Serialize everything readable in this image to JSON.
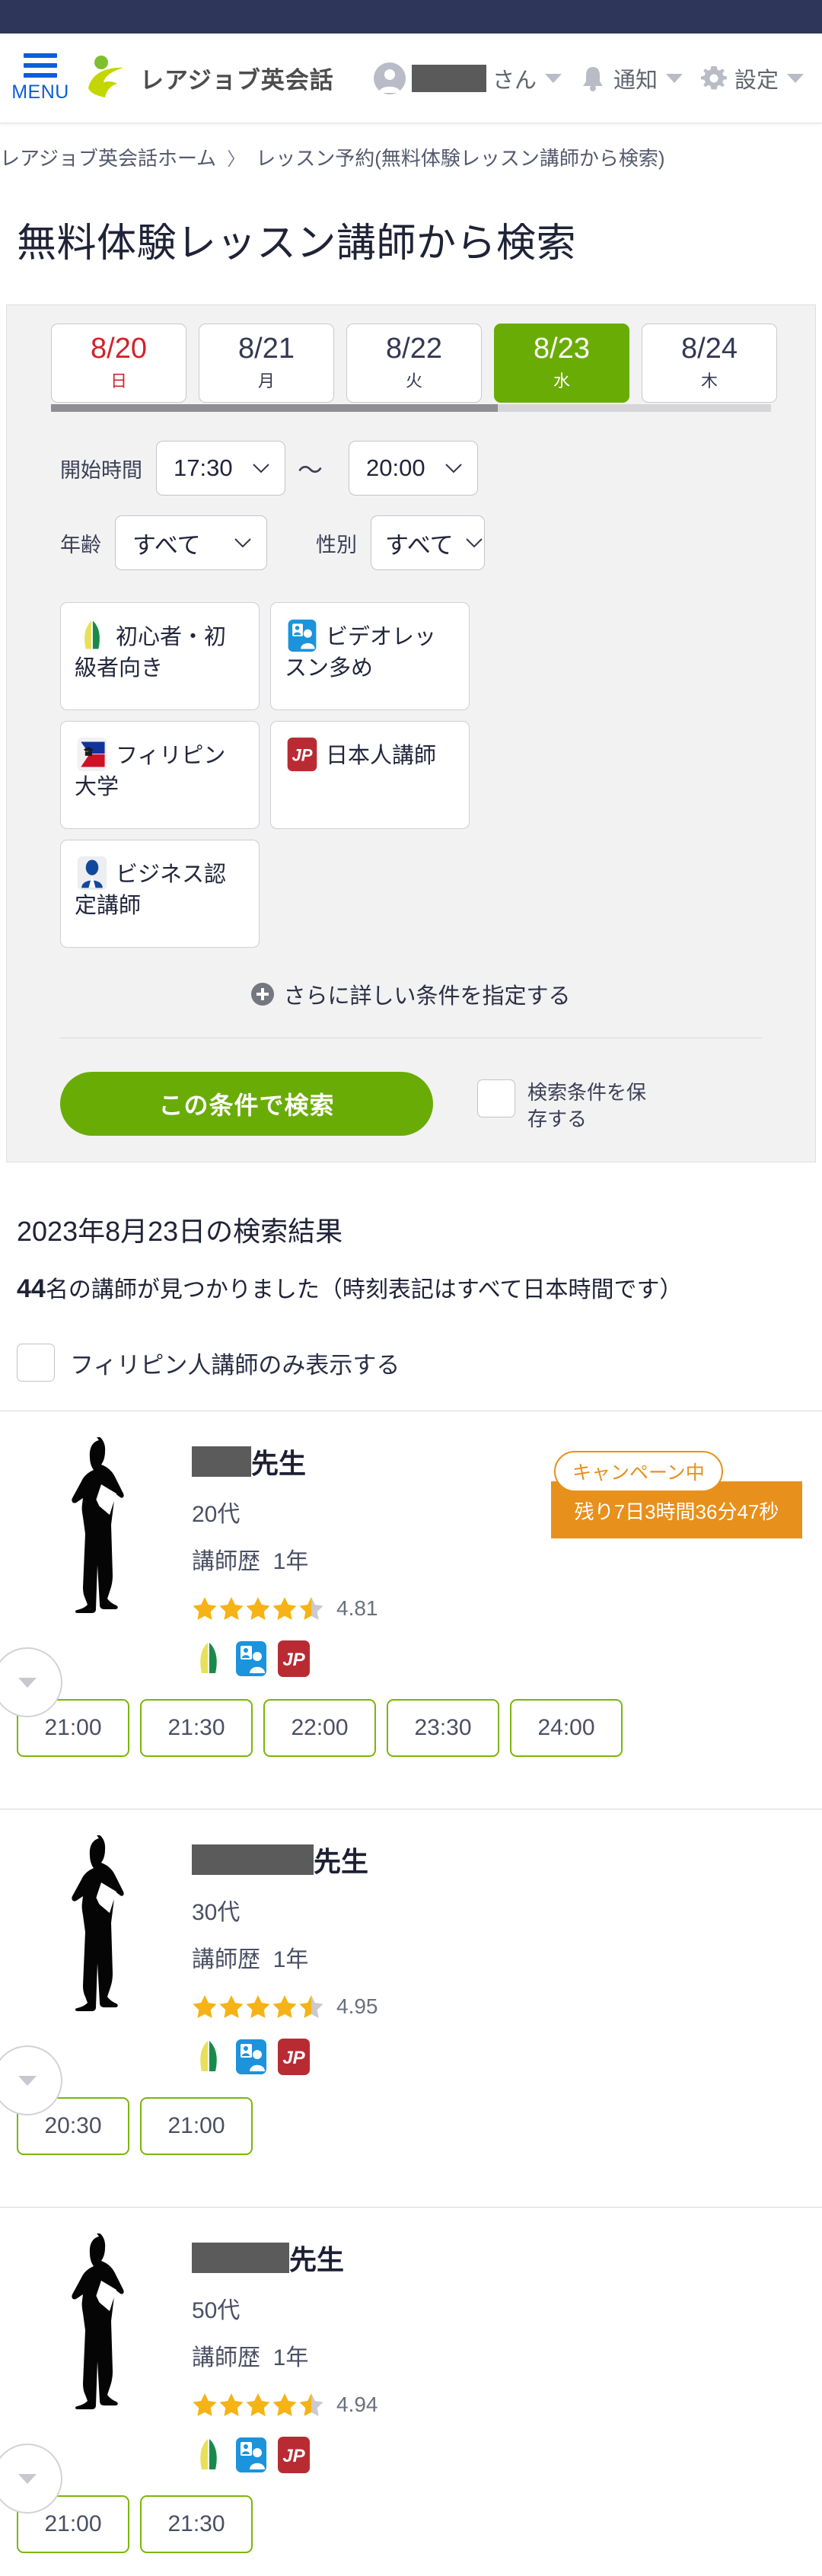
{
  "header": {
    "menu_label": "MENU",
    "brand_name": "レアジョブ英会話",
    "user_suffix": "さん",
    "notifications_label": "通知",
    "settings_label": "設定"
  },
  "breadcrumb": {
    "home": "レアジョブ英会話ホーム",
    "separator": "〉",
    "current": "レッスン予約(無料体験レッスン講師から検索)"
  },
  "page_title": "無料体験レッスン講師から検索",
  "filters": {
    "dates": [
      {
        "date": "8/20",
        "dow": "日",
        "holiday": true,
        "active": false
      },
      {
        "date": "8/21",
        "dow": "月",
        "holiday": false,
        "active": false
      },
      {
        "date": "8/22",
        "dow": "火",
        "holiday": false,
        "active": false
      },
      {
        "date": "8/23",
        "dow": "水",
        "holiday": false,
        "active": true
      },
      {
        "date": "8/24",
        "dow": "木",
        "holiday": false,
        "active": false
      }
    ],
    "start_time_label": "開始時間",
    "time_from": "17:30",
    "time_separator": "〜",
    "time_to": "20:00",
    "age_label": "年齢",
    "age_value": "すべて",
    "gender_label": "性別",
    "gender_value": "すべて",
    "chips": [
      {
        "icon": "beginner-leaf-icon",
        "label": "初心者・初級者向き"
      },
      {
        "icon": "video-lesson-icon",
        "label": "ビデオレッスン多め"
      },
      {
        "icon": "philippine-flag-icon",
        "label": "フィリピン大学"
      },
      {
        "icon": "japanese-teacher-icon",
        "label": "日本人講師"
      },
      {
        "icon": "business-certified-icon",
        "label": "ビジネス認定講師"
      }
    ],
    "more_conditions": "さらに詳しい条件を指定する",
    "search_button": "この条件で検索",
    "save_conditions": "検索条件を保存する",
    "accent_green": "#6aac06"
  },
  "results": {
    "title": "2023年8月23日の検索結果",
    "count": "44",
    "count_text": "名の講師が見つかりました（時刻表記はすべて日本時間です）",
    "philippine_only": "フィリピン人講師のみ表示する",
    "teacher_suffix": "先生",
    "experience_label": "講師歴",
    "teachers": [
      {
        "age": "20代",
        "experience": "1年",
        "rating": "4.81",
        "stars": 4.5,
        "badges": [
          "beginner-leaf-icon",
          "video-lesson-icon",
          "japanese-teacher-icon"
        ],
        "campaign_label": "キャンペーン中",
        "campaign_remaining": "残り7日3時間36分47秒",
        "name_mask_width": 78,
        "slots": [
          "21:00",
          "21:30",
          "22:00",
          "23:30",
          "24:00"
        ]
      },
      {
        "age": "30代",
        "experience": "1年",
        "rating": "4.95",
        "stars": 4.5,
        "badges": [
          "beginner-leaf-icon",
          "video-lesson-icon",
          "japanese-teacher-icon"
        ],
        "campaign_label": "",
        "campaign_remaining": "",
        "name_mask_width": 160,
        "slots": [
          "20:30",
          "21:00"
        ]
      },
      {
        "age": "50代",
        "experience": "1年",
        "rating": "4.94",
        "stars": 4.5,
        "badges": [
          "beginner-leaf-icon",
          "video-lesson-icon",
          "japanese-teacher-icon"
        ],
        "campaign_label": "",
        "campaign_remaining": "",
        "name_mask_width": 128,
        "slots": [
          "21:00",
          "21:30"
        ]
      }
    ]
  },
  "colors": {
    "topbar": "#2e3659",
    "brand_green": "#c3d600",
    "menu_blue": "#0b5ed7",
    "campaign_orange": "#e8901c",
    "star_gold": "#f5b315"
  }
}
